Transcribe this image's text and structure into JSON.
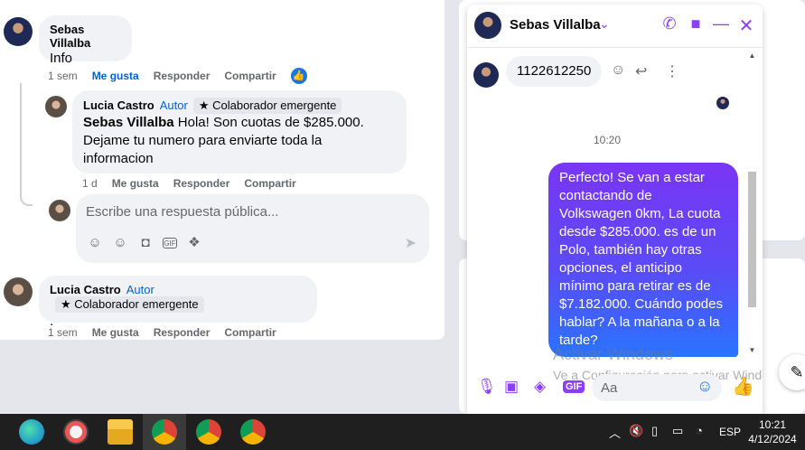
{
  "feed": {
    "comment1": {
      "author": "Sebas Villalba",
      "text": "Info",
      "time": "1 sem",
      "like": "Me gusta",
      "reply": "Responder",
      "share": "Compartir"
    },
    "reply1": {
      "author": "Lucia Castro",
      "autor_tag": "Autor",
      "badge": "Colaborador emergente",
      "mention": "Sebas Villalba",
      "text": " Hola! Son cuotas de $285.000. Dejame tu numero para enviarte toda la informacion",
      "time": "1 d",
      "like": "Me gusta",
      "reply": "Responder",
      "share": "Compartir"
    },
    "reply_box": {
      "placeholder": "Escribe una respuesta pública..."
    },
    "comment2": {
      "author": "Lucia Castro",
      "autor_tag": "Autor",
      "badge": "Colaborador emergente",
      "text": ".",
      "time": "1 sem",
      "like": "Me gusta",
      "reply": "Responder",
      "share": "Compartir"
    }
  },
  "chat": {
    "contact_name": "Sebas Villalba",
    "incoming_message": "1122612250",
    "time_separator": "10:20",
    "outgoing_message": "Perfecto!  Se van a estar contactando de Volkswagen 0km, La cuota desde $285.000. es de un Polo, también hay otras opciones, el anticipo mínimo para retirar es de $7.182.000. Cuándo podes hablar? A la mañana o a la tarde?",
    "input_placeholder": "Aa",
    "accent_color": "#8a3ffc"
  },
  "watermark": {
    "line1": "Activar Windows",
    "line2": "Ve a Configuración para activar Windows."
  },
  "taskbar": {
    "language": "ESP",
    "time": "10:21",
    "date": "4/12/2024"
  }
}
